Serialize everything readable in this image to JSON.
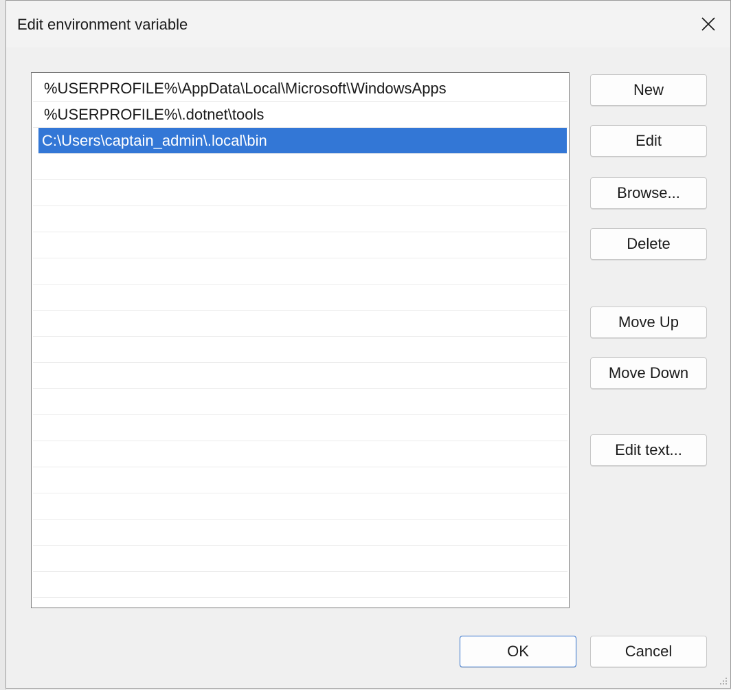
{
  "dialog": {
    "title": "Edit environment variable"
  },
  "list": {
    "items": [
      "%USERPROFILE%\\AppData\\Local\\Microsoft\\WindowsApps",
      "%USERPROFILE%\\.dotnet\\tools",
      "C:\\Users\\captain_admin\\.local\\bin"
    ],
    "selected_index": 2
  },
  "buttons": {
    "new": "New",
    "edit": "Edit",
    "browse": "Browse...",
    "delete": "Delete",
    "move_up": "Move Up",
    "move_down": "Move Down",
    "edit_text": "Edit text...",
    "ok": "OK",
    "cancel": "Cancel"
  },
  "colors": {
    "selection": "#3377d6",
    "default_button_border": "#2f6fcc"
  }
}
